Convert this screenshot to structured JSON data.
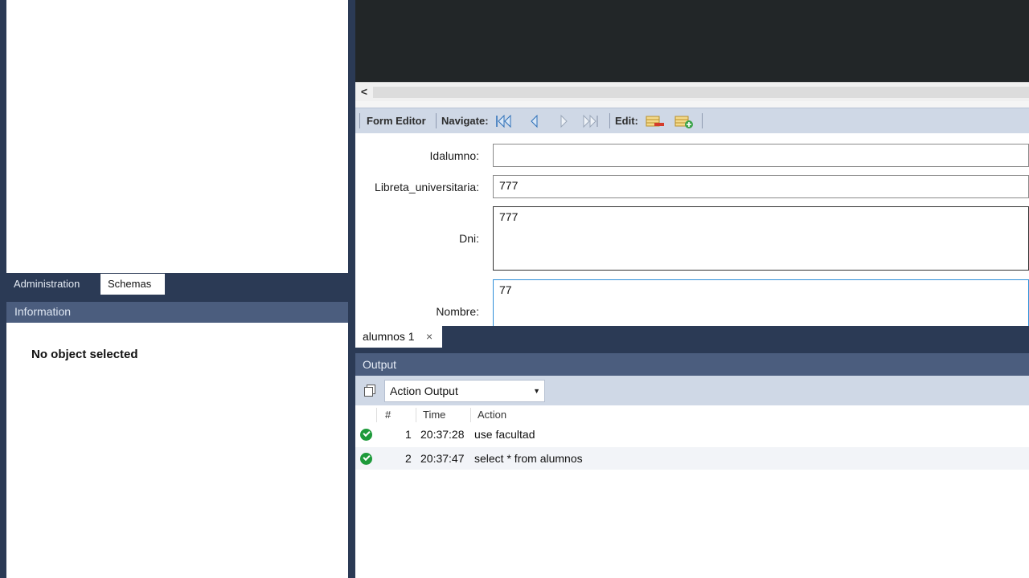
{
  "left": {
    "tabs": [
      "Administration",
      "Schemas"
    ],
    "info_header": "Information",
    "info_text": "No object selected"
  },
  "toolbar": {
    "form_editor": "Form Editor",
    "navigate": "Navigate:",
    "edit": "Edit:"
  },
  "form": {
    "fields": [
      {
        "label": "Idalumno:",
        "value": ""
      },
      {
        "label": "Libreta_universitaria:",
        "value": "777"
      },
      {
        "label": "Dni:",
        "value": "777"
      },
      {
        "label": "Nombre:",
        "value": "77"
      }
    ]
  },
  "doc_tab": {
    "label": "alumnos 1",
    "close": "×"
  },
  "output": {
    "header": "Output",
    "dropdown": "Action Output",
    "columns": [
      "#",
      "Time",
      "Action"
    ],
    "rows": [
      {
        "num": "1",
        "time": "20:37:28",
        "action": "use facultad"
      },
      {
        "num": "2",
        "time": "20:37:47",
        "action": "select * from alumnos"
      }
    ]
  }
}
